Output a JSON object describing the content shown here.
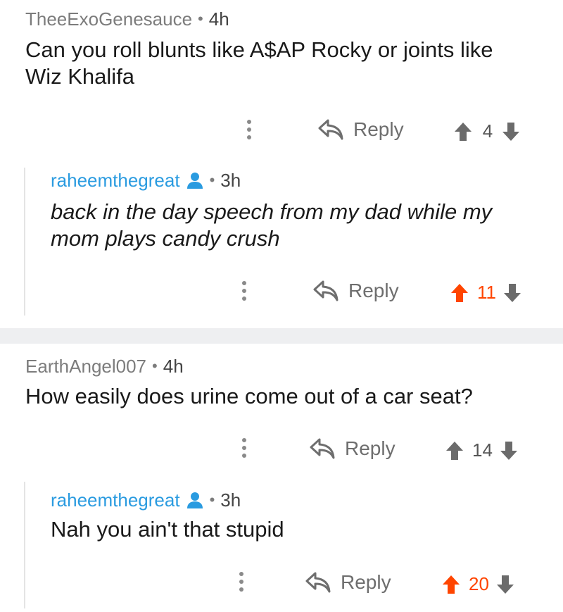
{
  "threads": [
    {
      "comment": {
        "author": "TheeExoGenesauce",
        "age": "4h",
        "text_line1": "Can you roll blunts like A$AP Rocky or joints like",
        "text_line2": "Wiz Khalifa",
        "reply_label": "Reply",
        "score": "4"
      },
      "reply": {
        "author": "raheemthegreat",
        "age": "3h",
        "text_line1": "back in the day speech from my dad while my",
        "text_line2": "mom plays candy crush",
        "reply_label": "Reply",
        "score": "11"
      }
    },
    {
      "comment": {
        "author": "EarthAngel007",
        "age": "4h",
        "text_line1": "How easily does urine come out of a car seat?",
        "reply_label": "Reply",
        "score": "14"
      },
      "reply": {
        "author": "raheemthegreat",
        "age": "3h",
        "text_line1": "Nah you ain't that stupid",
        "reply_label": "Reply",
        "score": "20"
      }
    }
  ],
  "separator": "•",
  "icons": {
    "more": "more-options-icon",
    "reply": "reply-arrow-icon",
    "upvote": "upvote-arrow-icon",
    "downvote": "downvote-arrow-icon",
    "user": "user-profile-icon"
  },
  "colors": {
    "reply_author": "#2a9be0",
    "upvoted": "#ff4500",
    "muted": "#7c7c7c",
    "divider": "#eeeff1"
  }
}
